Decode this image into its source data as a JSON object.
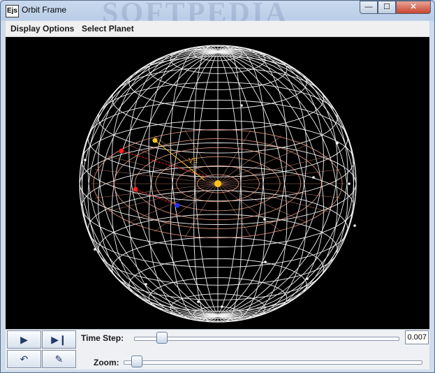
{
  "window": {
    "title": "Orbit Frame",
    "icon_text": "Ejs",
    "watermark": "SOFTPEDIA"
  },
  "title_buttons": {
    "minimize": "—",
    "maximize": "☐",
    "close": "✕"
  },
  "menu": {
    "items": [
      "Display Options",
      "Select Planet"
    ]
  },
  "scene": {
    "label": "VE"
  },
  "controls": {
    "play_icon": "play-icon",
    "step_icon": "step-icon",
    "reset_icon": "reset-icon",
    "edit_icon": "pencil-icon",
    "time_step_label": "Time Step:",
    "time_step_value": "0.007",
    "time_step_fraction": 0.1,
    "zoom_label": "Zoom:",
    "zoom_fraction": 0.04
  },
  "colors": {
    "grid": "#f2f2f2",
    "orbit": "#f4a48c",
    "sun": "#ffc61a",
    "planet_red": "#ff2020",
    "planet_blue": "#2030ff",
    "label": "#e0b020"
  }
}
